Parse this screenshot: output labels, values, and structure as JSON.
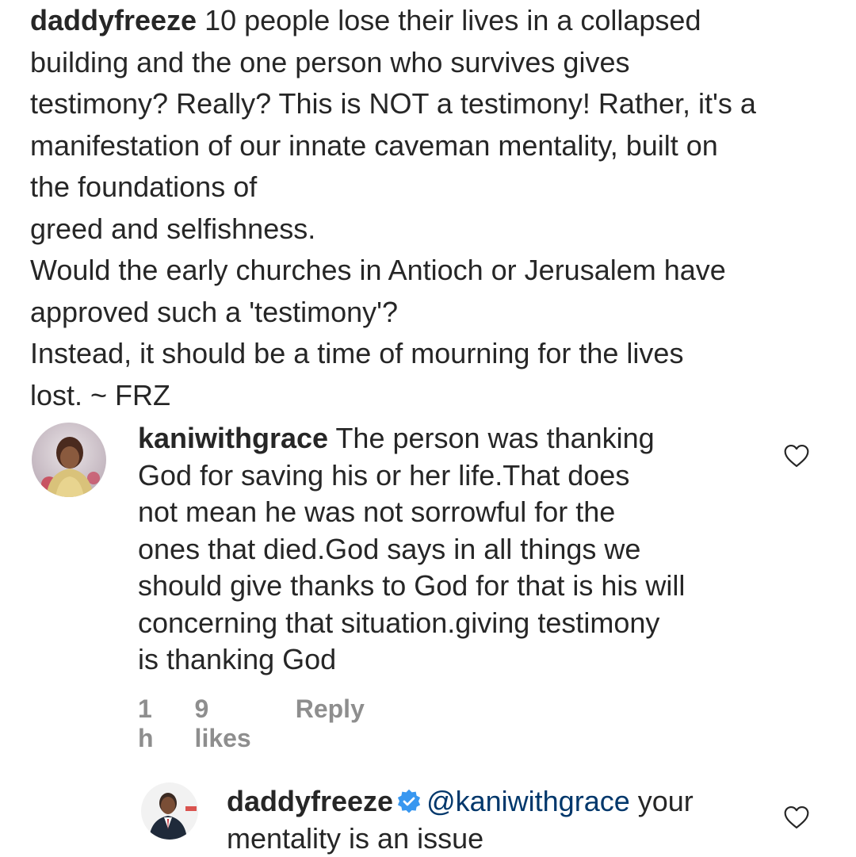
{
  "main_comment": {
    "username": "daddyfreeze",
    "lines": [
      " 10 people lose their lives in a collapsed",
      "building and the one person who survives gives",
      "testimony? Really? This is NOT a testimony! Rather, it's a",
      "manifestation of our innate caveman mentality, built on",
      "the foundations of",
      "greed and selfishness.",
      "Would the early churches in Antioch or Jerusalem have",
      "approved such a 'testimony'?",
      "Instead, it should be a time of mourning for the lives",
      "lost. ~ FRZ"
    ]
  },
  "reply_1": {
    "username": "kaniwithgrace",
    "lines": [
      " The person was thanking",
      "God for saving his or her life.That does",
      "not mean he was not sorrowful for the",
      "ones that died.God says in all things we",
      "should give thanks to God for that is his will",
      "concerning that situation.giving testimony",
      "is thanking God"
    ],
    "time": "1 h",
    "likes": "9 likes",
    "reply_label": "Reply"
  },
  "reply_2": {
    "username": "daddyfreeze",
    "mention": "@kaniwithgrace",
    "lines": [
      " your",
      "mentality is an issue"
    ]
  },
  "colors": {
    "text": "#262626",
    "meta": "#8e8e8e",
    "mention": "#00376b",
    "verified": "#3897f0"
  }
}
